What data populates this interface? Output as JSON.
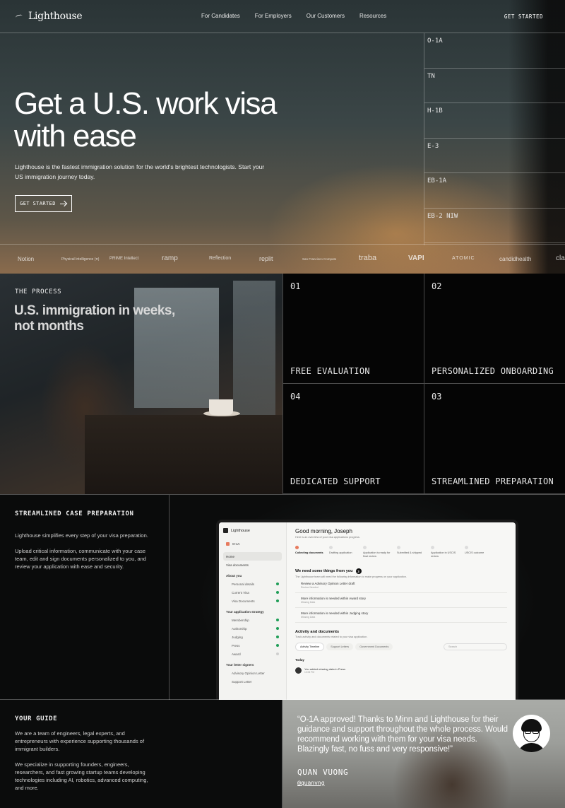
{
  "nav": {
    "brand": "Lighthouse",
    "links": [
      "For Candidates",
      "For Employers",
      "Our Customers",
      "Resources"
    ],
    "cta": "GET STARTED"
  },
  "hero": {
    "title": "Get a U.S. work visa with ease",
    "subtitle": "Lighthouse is the fastest immigration solution for the world's brightest technologists. Start your US immigration journey today.",
    "cta": "GET STARTED",
    "visas": [
      "O-1A",
      "TN",
      "H-1B",
      "E-3",
      "EB-1A",
      "EB-2 NIW"
    ]
  },
  "logos": [
    "Notion",
    "Physical Intelligence (π)",
    "PRIME Intellect",
    "ramp",
    "Reflection",
    "replit",
    "San Francisco Compute",
    "traba",
    "VAPI",
    "ATOMIC",
    "candidhealth",
    "cla"
  ],
  "process": {
    "label": "THE PROCESS",
    "title": "U.S. immigration in weeks, not months",
    "steps": [
      {
        "num": "01",
        "name": "FREE EVALUATION"
      },
      {
        "num": "02",
        "name": "PERSONALIZED ONBOARDING"
      },
      {
        "num": "04",
        "name": "DEDICATED SUPPORT"
      },
      {
        "num": "03",
        "name": "STREAMLINED PREPARATION"
      }
    ]
  },
  "case": {
    "heading": "STREAMLINED CASE PREPARATION",
    "p1": "Lighthouse simplifies every step of your visa preparation.",
    "p2": "Upload critical information, communicate with your case team, edit and sign documents personalized to you, and review your application with ease and security."
  },
  "app": {
    "brand": "Lighthouse",
    "visa": "O-1A",
    "sidebar": {
      "home": "Home",
      "visa_documents": "Visa documents",
      "about_you": "About you",
      "about_items": [
        "Personal details",
        "Current Visa",
        "Visa Documents"
      ],
      "strategy": "Your application strategy",
      "strategy_items": [
        "Membership",
        "Authorship",
        "Judging",
        "Press",
        "Award"
      ],
      "signers": "Your letter signers",
      "signer_items": [
        "Advisory Opinion Letter",
        "Support Letter"
      ]
    },
    "greeting": "Good morning, Joseph",
    "greeting_sub": "Here is an overview of your visa applications progress.",
    "stages": [
      "Collecting documents",
      "Drafting application",
      "Application is ready for final review",
      "Submitted & shipped",
      "Application in USCIS review",
      "USCIS outcome"
    ],
    "need_title": "We need some things from you",
    "need_count": "3",
    "need_sub": "The Lighthouse team will need the following information to make progress on your application.",
    "tasks": [
      {
        "text": "Review a Advisory Opinion Letter draft",
        "meta": "Review Needed"
      },
      {
        "text": "More information is needed within Award story",
        "meta": "Missing Data"
      },
      {
        "text": "More information is needed within Judging story",
        "meta": "Missing Data"
      }
    ],
    "activity_title": "Activity and documents",
    "activity_sub": "Track activity and documents related to your visa application.",
    "activity_tabs": [
      "Activity Timeline",
      "Support Letters",
      "Government Documents"
    ],
    "search_placeholder": "Search",
    "today": "Today",
    "feed_text": "You added missing data in Press",
    "feed_time": "10:05 PM"
  },
  "guide": {
    "heading": "YOUR GUIDE",
    "p1": "We are a team of engineers, legal experts, and entrepreneurs with experience supporting thousands of immigrant builders.",
    "p2": "We specialize in supporting founders, engineers, researchers, and fast growing startup teams developing technologies including AI, robotics, advanced computing, and more."
  },
  "testimonial": {
    "quote": "“O-1A approved! Thanks to Minn and Lighthouse for their guidance and support throughout the whole process. Would recommend working with them for your visa needs. Blazingly fast, no fuss and very responsive!”",
    "name": "QUAN VUONG",
    "handle": "@quanvng"
  }
}
